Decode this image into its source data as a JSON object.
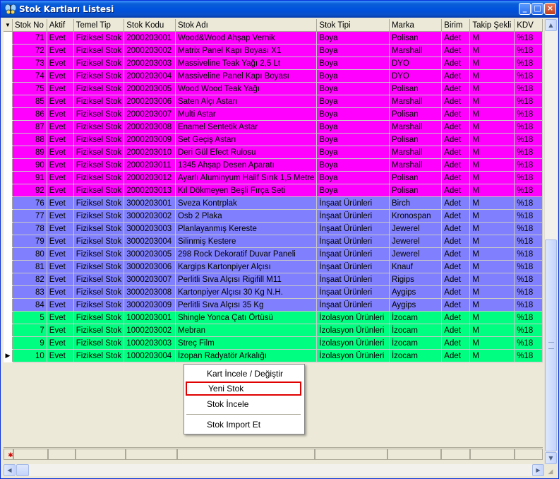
{
  "window": {
    "title": "Stok Kartları Listesi",
    "minimize": "_",
    "maximize": "□",
    "close": "×"
  },
  "grid": {
    "columns": [
      "Stok No",
      "Aktif",
      "Temel Tip",
      "Stok Kodu",
      "Stok Adı",
      "Stok Tipi",
      "Marka",
      "Birim",
      "Takip Şekli",
      "KDV"
    ],
    "rows": [
      {
        "group": "boya",
        "cells": [
          "71",
          "Evet",
          "Fiziksel Stok",
          "2000203001",
          "Wood&Wood Ahşap Vernik",
          "Boya",
          "Polisan",
          "Adet",
          "M",
          "%18"
        ]
      },
      {
        "group": "boya",
        "cells": [
          "72",
          "Evet",
          "Fiziksel Stok",
          "2000203002",
          "Matrix Panel Kapı Boyası X1",
          "Boya",
          "Marshall",
          "Adet",
          "M",
          "%18"
        ]
      },
      {
        "group": "boya",
        "cells": [
          "73",
          "Evet",
          "Fiziksel Stok",
          "2000203003",
          "Massiveline Teak Yağı 2,5 Lt",
          "Boya",
          "DYO",
          "Adet",
          "M",
          "%18"
        ]
      },
      {
        "group": "boya",
        "cells": [
          "74",
          "Evet",
          "Fiziksel Stok",
          "2000203004",
          "Massiveline Panel Kapı Boyası",
          "Boya",
          "DYO",
          "Adet",
          "M",
          "%18"
        ]
      },
      {
        "group": "boya",
        "cells": [
          "75",
          "Evet",
          "Fiziksel Stok",
          "2000203005",
          "Wood Wood Teak Yağı",
          "Boya",
          "Polisan",
          "Adet",
          "M",
          "%18"
        ]
      },
      {
        "group": "boya",
        "cells": [
          "85",
          "Evet",
          "Fiziksel Stok",
          "2000203006",
          "Saten Alçı Astarı",
          "Boya",
          "Marshall",
          "Adet",
          "M",
          "%18"
        ]
      },
      {
        "group": "boya",
        "cells": [
          "86",
          "Evet",
          "Fiziksel Stok",
          "2000203007",
          "Multi Astar",
          "Boya",
          "Polisan",
          "Adet",
          "M",
          "%18"
        ]
      },
      {
        "group": "boya",
        "cells": [
          "87",
          "Evet",
          "Fiziksel Stok",
          "2000203008",
          "Enamel Sentetik Astar",
          "Boya",
          "Marshall",
          "Adet",
          "M",
          "%18"
        ]
      },
      {
        "group": "boya",
        "cells": [
          "88",
          "Evet",
          "Fiziksel Stok",
          "2000203009",
          "Set Geçiş Astarı",
          "Boya",
          "Polisan",
          "Adet",
          "M",
          "%18"
        ]
      },
      {
        "group": "boya",
        "cells": [
          "89",
          "Evet",
          "Fiziksel Stok",
          "2000203010",
          "Deri Gül Efect Rulosu",
          "Boya",
          "Marshall",
          "Adet",
          "M",
          "%18"
        ]
      },
      {
        "group": "boya",
        "cells": [
          "90",
          "Evet",
          "Fiziksel Stok",
          "2000203011",
          "1345 Ahşap Desen Aparatı",
          "Boya",
          "Marshall",
          "Adet",
          "M",
          "%18"
        ]
      },
      {
        "group": "boya",
        "cells": [
          "91",
          "Evet",
          "Fiziksel Stok",
          "2000203012",
          "Ayarlı Aluminyum Halif Sırık 1,5 Metre",
          "Boya",
          "Polisan",
          "Adet",
          "M",
          "%18"
        ]
      },
      {
        "group": "boya",
        "cells": [
          "92",
          "Evet",
          "Fiziksel Stok",
          "2000203013",
          "Kıl Dökmeyen Beşli Fırça Seti",
          "Boya",
          "Polisan",
          "Adet",
          "M",
          "%18"
        ]
      },
      {
        "group": "insaat",
        "cells": [
          "76",
          "Evet",
          "Fiziksel Stok",
          "3000203001",
          "Sveza Kontrplak",
          "İnşaat Ürünleri",
          "Birch",
          "Adet",
          "M",
          "%18"
        ]
      },
      {
        "group": "insaat",
        "cells": [
          "77",
          "Evet",
          "Fiziksel Stok",
          "3000203002",
          "Osb 2 Plaka",
          "İnşaat Ürünleri",
          "Kronospan",
          "Adet",
          "M",
          "%18"
        ]
      },
      {
        "group": "insaat",
        "cells": [
          "78",
          "Evet",
          "Fiziksel Stok",
          "3000203003",
          "Planlayanmış Kereste",
          "İnşaat Ürünleri",
          "Jewerel",
          "Adet",
          "M",
          "%18"
        ]
      },
      {
        "group": "insaat",
        "cells": [
          "79",
          "Evet",
          "Fiziksel Stok",
          "3000203004",
          "Silinmiş Kestere",
          "İnşaat Ürünleri",
          "Jewerel",
          "Adet",
          "M",
          "%18"
        ]
      },
      {
        "group": "insaat",
        "cells": [
          "80",
          "Evet",
          "Fiziksel Stok",
          "3000203005",
          "298 Rock Dekoratif Duvar Paneli",
          "İnşaat Ürünleri",
          "Jewerel",
          "Adet",
          "M",
          "%18"
        ]
      },
      {
        "group": "insaat",
        "cells": [
          "81",
          "Evet",
          "Fiziksel Stok",
          "3000203006",
          "Kargips Kartonpiyer Alçısı",
          "İnşaat Ürünleri",
          "Knauf",
          "Adet",
          "M",
          "%18"
        ]
      },
      {
        "group": "insaat",
        "cells": [
          "82",
          "Evet",
          "Fiziksel Stok",
          "3000203007",
          "Perlitli Sıva Alçısı Rigifill M11",
          "İnşaat Ürünleri",
          "Rigips",
          "Adet",
          "M",
          "%18"
        ]
      },
      {
        "group": "insaat",
        "cells": [
          "83",
          "Evet",
          "Fiziksel Stok",
          "3000203008",
          "Kartonpiyer Alçısı 30 Kg N.H.",
          "İnşaat Ürünleri",
          "Aygips",
          "Adet",
          "M",
          "%18"
        ]
      },
      {
        "group": "insaat",
        "cells": [
          "84",
          "Evet",
          "Fiziksel Stok",
          "3000203009",
          "Perlitli Sıva Alçısı 35 Kg",
          "İnşaat Ürünleri",
          "Aygips",
          "Adet",
          "M",
          "%18"
        ]
      },
      {
        "group": "izolasyon",
        "cells": [
          "5",
          "Evet",
          "Fiziksel Stok",
          "1000203001",
          "Shingle Yonca Çatı Örtüsü",
          "İzolasyon Ürünleri",
          "İzocam",
          "Adet",
          "M",
          "%18"
        ]
      },
      {
        "group": "izolasyon",
        "cells": [
          "7",
          "Evet",
          "Fiziksel Stok",
          "1000203002",
          "Mebran",
          "İzolasyon Ürünleri",
          "İzocam",
          "Adet",
          "M",
          "%18"
        ]
      },
      {
        "group": "izolasyon",
        "cells": [
          "9",
          "Evet",
          "Fiziksel Stok",
          "1000203003",
          "Streç Film",
          "İzolasyon Ürünleri",
          "İzocam",
          "Adet",
          "M",
          "%18"
        ]
      },
      {
        "group": "izolasyon",
        "cells": [
          "10",
          "Evet",
          "Fiziksel Stok",
          "1000203004",
          "İzopan Radyatör Arkalığı",
          "İzolasyon Ürünleri",
          "İzocam",
          "Adet",
          "M",
          "%18"
        ]
      }
    ],
    "current_row_index": 25,
    "row_indicator": "▶",
    "sort_indicator": "▼",
    "group_colors": {
      "boya": "#ff00ff",
      "insaat": "#8080ff",
      "izolasyon": "#00ff80"
    }
  },
  "context_menu": {
    "items": [
      {
        "label": "Kart İncele / Değiştir",
        "highlighted": false
      },
      {
        "label": "Yeni Stok",
        "highlighted": true
      },
      {
        "label": "Stok İncele",
        "highlighted": false
      },
      {
        "label": "Stok Import Et",
        "highlighted": false
      }
    ]
  },
  "icons": {
    "title": "butterfly-icon",
    "filter": "filter-icon",
    "scroll_up": "▲",
    "scroll_down": "▼",
    "scroll_left": "◀",
    "scroll_right": "▶"
  }
}
